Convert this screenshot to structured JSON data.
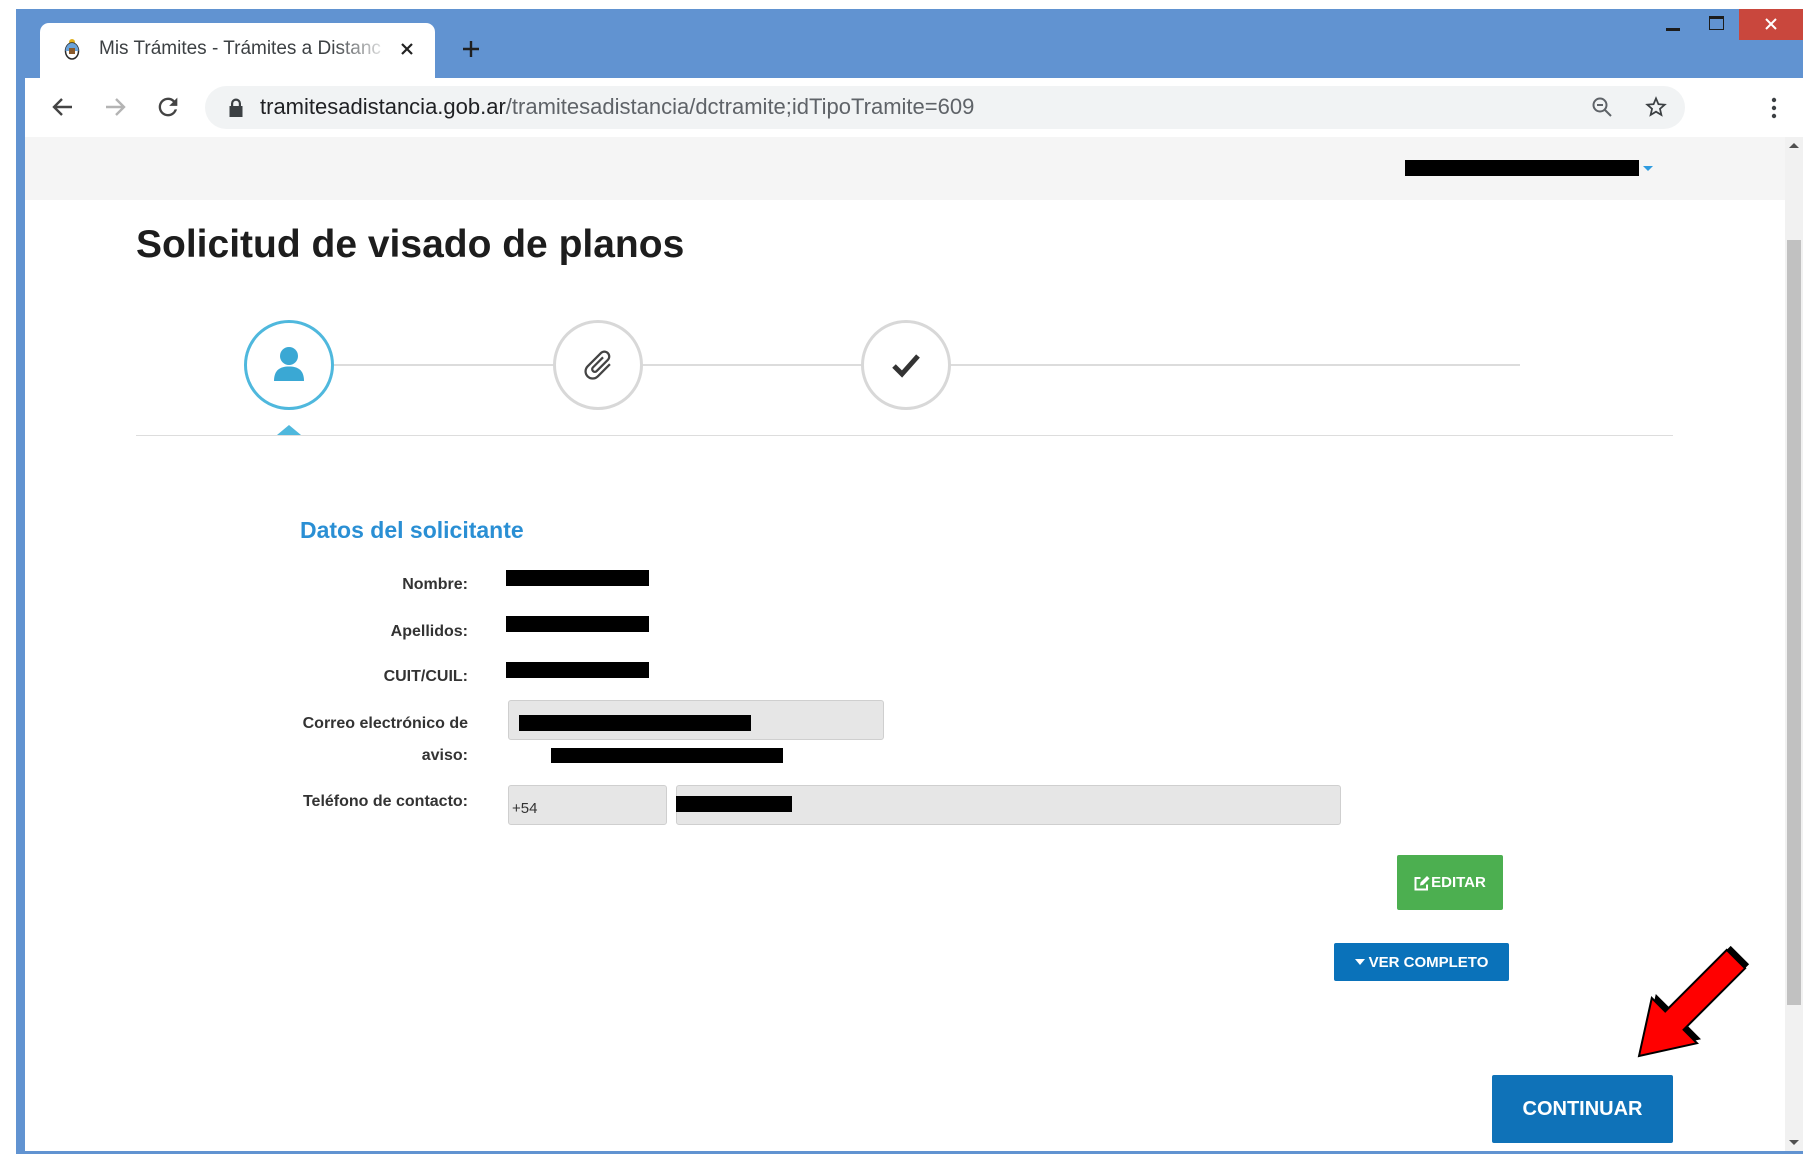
{
  "browser": {
    "tab": {
      "title": "Mis Trámites - Trámites a Distanc",
      "favicon": "coat-of-arms-icon",
      "close_icon": "close-icon"
    },
    "new_tab_icon": "plus-icon",
    "window_controls": [
      "minimize-icon",
      "maximize-icon",
      "close-icon"
    ],
    "toolbar": {
      "icons": [
        "back-arrow-icon",
        "forward-arrow-icon",
        "reload-icon",
        "lock-icon",
        "zoom-icon",
        "star-icon",
        "menu-icon"
      ],
      "url_domain": "tramitesadistancia.gob.ar",
      "url_path": "/tramitesadistancia/dctramite;idTipoTramite=609"
    }
  },
  "page": {
    "title": "Solicitud de visado de planos",
    "steps": [
      {
        "icon": "user-icon",
        "state": "active"
      },
      {
        "icon": "paperclip-icon",
        "state": "pending"
      },
      {
        "icon": "check-icon",
        "state": "pending"
      }
    ],
    "section_title": "Datos del solicitante",
    "fields": [
      {
        "label": "Nombre:"
      },
      {
        "label": "Apellidos:"
      },
      {
        "label": "CUIT/CUIL:"
      },
      {
        "label": "Correo electrónico de aviso:"
      },
      {
        "label": "Teléfono de contacto:",
        "prefix": "+54"
      }
    ],
    "buttons": {
      "edit": "EDITAR",
      "edit_icon": "edit-icon",
      "view_full": "VER COMPLETO",
      "view_full_icon": "caret-down-icon",
      "continue": "CONTINUAR"
    },
    "annotation_icon": "red-arrow-icon"
  },
  "colors": {
    "window_frame": "#6193d1",
    "window_close": "#c9473d",
    "step_active": "#4fb8dd",
    "section_title": "#2a8fd4",
    "edit_button": "#4caf50",
    "primary_button": "#0f72b8",
    "annotation_arrow": "#ff0000"
  }
}
